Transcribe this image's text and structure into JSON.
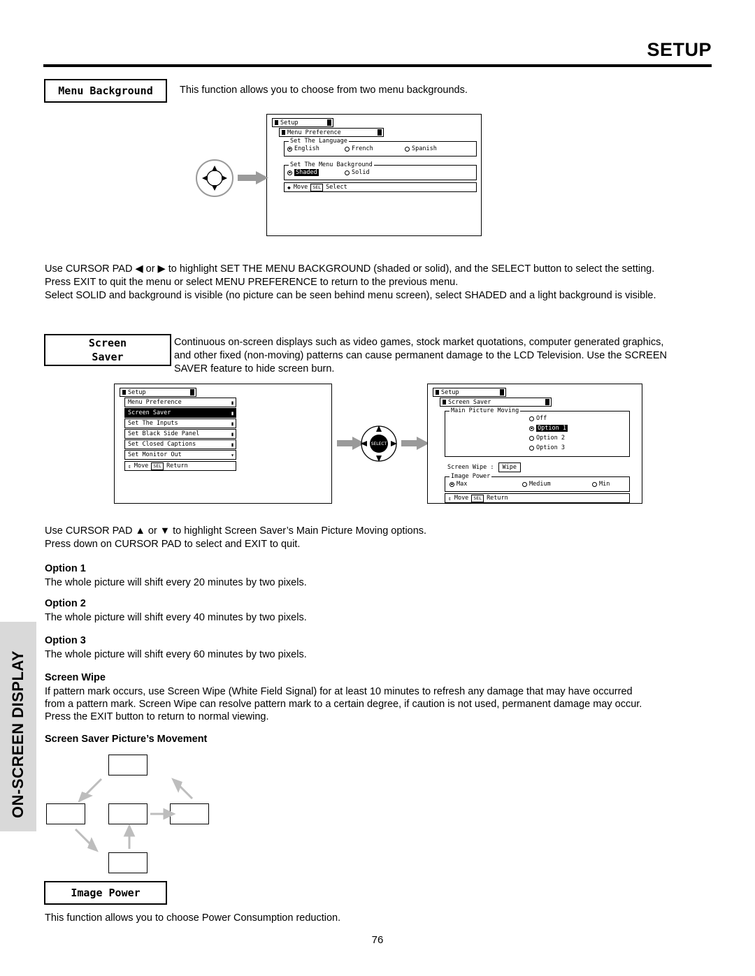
{
  "header": {
    "title": "SETUP"
  },
  "side_tab": {
    "label": "ON-SCREEN DISPLAY"
  },
  "sections": {
    "menu_background": {
      "label": "Menu Background",
      "intro": "This function allows you to choose from two menu backgrounds.",
      "osd": {
        "title_tab": "Setup",
        "sub_tab": "Menu Preference",
        "group1_title": "Set The Language",
        "group1_options": [
          "English",
          "French",
          "Spanish"
        ],
        "group1_selected": "English",
        "group2_title": "Set The Menu Background",
        "group2_options": [
          "Shaded",
          "Solid"
        ],
        "group2_selected": "Shaded",
        "bottom_move": "Move",
        "bottom_key": "SEL",
        "bottom_action": "Select"
      },
      "body_line1": "Use CURSOR PAD ◀ or ▶ to highlight SET THE MENU BACKGROUND (shaded or solid), and the SELECT button to select the setting.",
      "body_line2": "Press EXIT to quit the menu or select MENU PREFERENCE to return to the previous menu.",
      "body_line3": "Select SOLID and background is visible (no picture can be seen behind menu screen), select SHADED and a light background is visible."
    },
    "screen_saver": {
      "label_line1": "Screen",
      "label_line2": "Saver",
      "intro_line1": "Continuous on-screen displays such as video games, stock market quotations, computer generated graphics,",
      "intro_line2": "and other fixed (non-moving) patterns can cause permanent damage to the LCD Television.  Use the SCREEN",
      "intro_line3": "SAVER feature to hide screen burn.",
      "osd_left": {
        "title_tab": "Setup",
        "items": [
          "Menu Preference",
          "Screen Saver",
          "Set The Inputs",
          "Set Black Side Panel",
          "Set Closed Captions",
          "Set Monitor Out"
        ],
        "selected_item": "Screen Saver",
        "bottom_move": "Move",
        "bottom_key": "SEL",
        "bottom_action": "Return"
      },
      "osd_right": {
        "title_tab": "Setup",
        "sub_tab": "Screen Saver",
        "group_title": "Main Picture Moving",
        "options": [
          "Off",
          "Option 1",
          "Option 2",
          "Option 3"
        ],
        "selected_option": "Option 1",
        "screen_wipe_label": "Screen Wipe :",
        "screen_wipe_value": "Wipe",
        "image_power_title": "Image Power",
        "image_power_options": [
          "Max",
          "Medium",
          "Min"
        ],
        "image_power_selected": "Max",
        "bottom_move": "Move",
        "bottom_key": "SEL",
        "bottom_action": "Return"
      },
      "pad_label": "SELECT",
      "body_line1": "Use CURSOR PAD ▲ or ▼ to highlight Screen Saver’s Main Picture Moving options.",
      "body_line2": "Press down on CURSOR PAD to select and EXIT to quit.",
      "options": [
        {
          "title": "Option 1",
          "text": "The whole picture will shift every 20 minutes by two pixels."
        },
        {
          "title": "Option 2",
          "text": "The whole picture will shift every 40 minutes by two pixels."
        },
        {
          "title": "Option 3",
          "text": "The whole picture will shift every 60 minutes by two pixels."
        }
      ],
      "screen_wipe": {
        "title": "Screen Wipe",
        "line1": "If pattern mark occurs, use Screen Wipe (White Field Signal) for at least 10 minutes to refresh any damage that may have occurred",
        "line2": "from a pattern mark.  Screen Wipe can resolve pattern mark to a certain degree, if caution is not used, permanent damage may occur.",
        "line3": "Press the EXIT button to return to normal viewing."
      },
      "movement": {
        "title": "Screen Saver Picture’s Movement"
      }
    },
    "image_power": {
      "label": "Image Power",
      "text": "This function allows you to choose Power Consumption reduction."
    }
  },
  "footer": {
    "page_number": "76"
  }
}
